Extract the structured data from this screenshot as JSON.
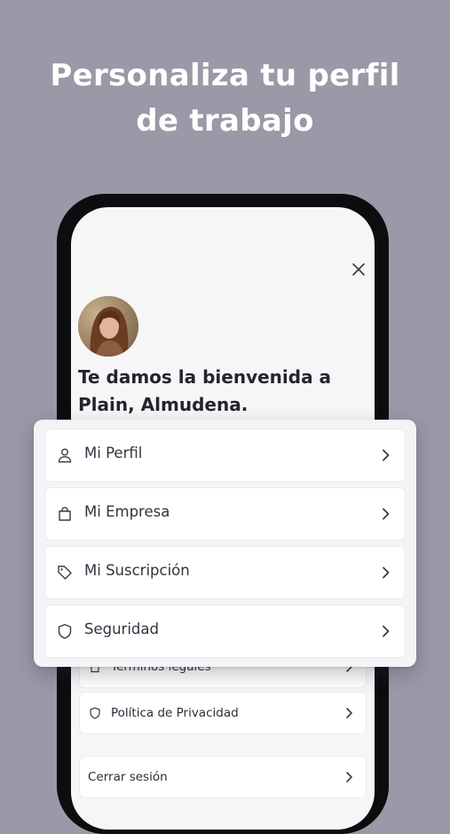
{
  "headline": {
    "line1": "Personaliza tu perfil",
    "line2": "de trabajo"
  },
  "profile": {
    "welcome_line1": "Te damos la bienvenida a",
    "welcome_line2": "Plain, Almudena."
  },
  "menu": {
    "items": [
      {
        "label": "Mi Perfil",
        "icon": "user-icon"
      },
      {
        "label": "Mi Empresa",
        "icon": "bag-icon"
      },
      {
        "label": "Mi Suscripción",
        "icon": "tag-icon"
      },
      {
        "label": "Seguridad",
        "icon": "shield-icon"
      }
    ]
  },
  "background_menu": {
    "items": [
      {
        "label": "Términos legales",
        "icon": "document-icon"
      },
      {
        "label": "Política de Privacidad",
        "icon": "shield-icon"
      },
      {
        "label": "Cerrar sesión"
      }
    ]
  },
  "colors": {
    "background": "#9b98a7",
    "phone_frame": "#0d0d10",
    "screen": "#f6f6f7",
    "text_dark": "#24242f",
    "icon": "#3a3a46"
  }
}
